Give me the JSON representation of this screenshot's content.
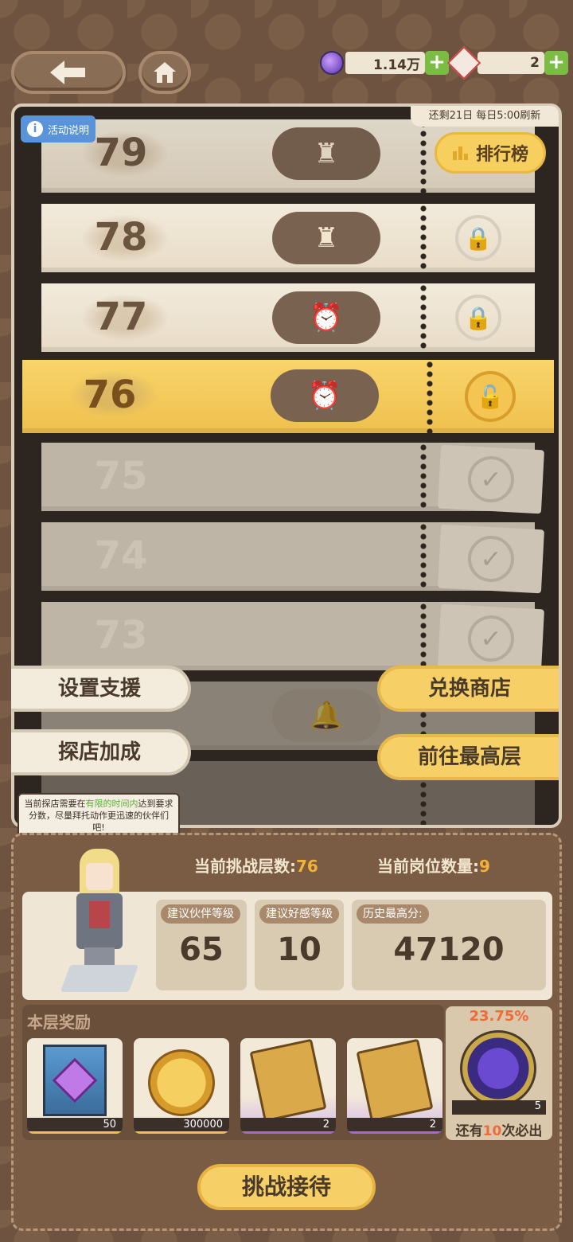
{
  "header": {
    "back_icon": "arrow-left-icon",
    "home_icon": "home-icon",
    "resources": [
      {
        "icon": "purple-gem-icon",
        "value": "1.14万"
      },
      {
        "icon": "ticket-icon",
        "value": "2"
      }
    ],
    "plus": "+"
  },
  "tower": {
    "info_label": "活动说明",
    "info_icon_glyph": "i",
    "remaining": "还剩21日 每日5:00刷新",
    "rank_label": "排行榜",
    "floors": [
      {
        "number": "79",
        "state": "locked"
      },
      {
        "number": "78",
        "state": "locked"
      },
      {
        "number": "77",
        "state": "locked"
      },
      {
        "number": "76",
        "state": "current"
      },
      {
        "number": "75",
        "state": "done"
      },
      {
        "number": "74",
        "state": "done"
      },
      {
        "number": "73",
        "state": "done"
      }
    ],
    "icons": {
      "lock": "🔒",
      "unlock": "🔓",
      "check": "✓",
      "chef": "♜",
      "clock": "⏰",
      "bell": "🔔"
    }
  },
  "side_buttons": {
    "set_support": "设置支援",
    "shop_bonus": "探店加成",
    "exchange_shop": "兑换商店",
    "go_top": "前往最高层"
  },
  "speech": {
    "prefix": "当前探店需要在",
    "highlight": "有限的时间内",
    "suffix": "达到要求分数，尽量拜托动作更迅速的伙伴们吧!"
  },
  "stats": {
    "current_floor_label": "当前挑战层数:",
    "current_floor_value": "76",
    "slots_label": "当前岗位数量:",
    "slots_value": "9",
    "suggest_partner_label": "建议伙伴等级",
    "suggest_partner_value": "65",
    "suggest_affinity_label": "建议好感等级",
    "suggest_affinity_value": "10",
    "best_score_label": "历史最高分:",
    "best_score_value": "47120"
  },
  "rewards": {
    "title": "本层奖励",
    "items": [
      {
        "icon": "purple-gem-banner-icon",
        "count": "50"
      },
      {
        "icon": "gold-coin-icon",
        "count": "300000"
      },
      {
        "icon": "golden-book-icon",
        "count": "2"
      },
      {
        "icon": "golden-book-icon",
        "count": "2"
      }
    ],
    "special": {
      "icon": "purple-star-medal-icon",
      "rate": "23.75%",
      "count": "5",
      "guarantee_prefix": "还有",
      "guarantee_num": "10",
      "guarantee_suffix": "次必出"
    }
  },
  "cta": {
    "label": "挑战接待"
  },
  "colors": {
    "accent": "#f6d067",
    "bg": "#6e5440",
    "highlight_green": "#5cae3a",
    "orange": "#f2b23a"
  }
}
